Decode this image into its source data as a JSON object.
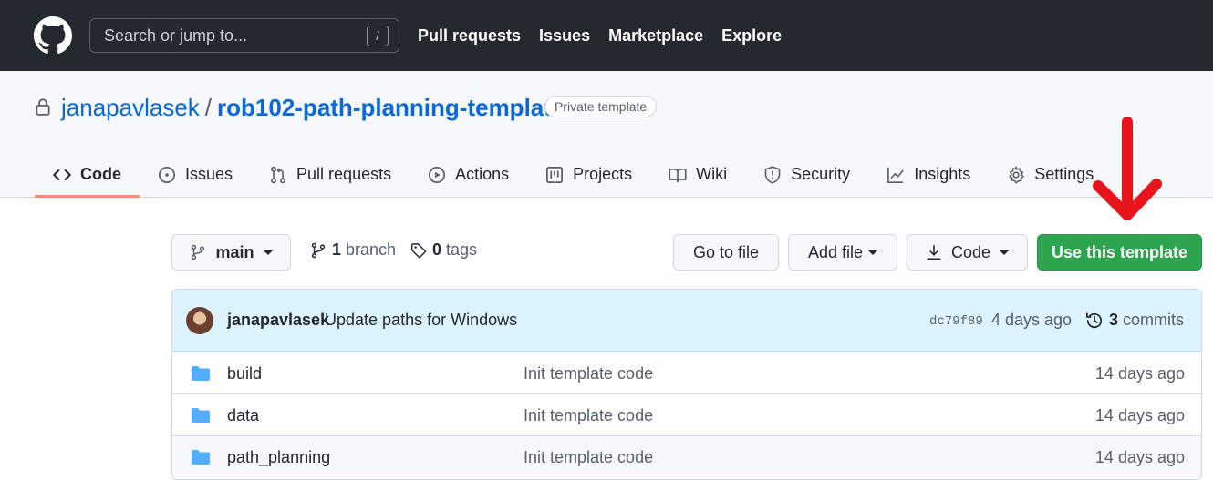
{
  "header": {
    "search_placeholder": "Search or jump to...",
    "search_shortcut": "/",
    "nav": [
      "Pull requests",
      "Issues",
      "Marketplace",
      "Explore"
    ]
  },
  "repo": {
    "owner": "janapavlasek",
    "separator": "/",
    "name": "rob102-path-planning-template",
    "badge": "Private template"
  },
  "tabs": [
    {
      "label": "Code",
      "icon": "code-icon",
      "selected": true
    },
    {
      "label": "Issues",
      "icon": "issue-opened-icon"
    },
    {
      "label": "Pull requests",
      "icon": "git-pull-request-icon"
    },
    {
      "label": "Actions",
      "icon": "play-icon"
    },
    {
      "label": "Projects",
      "icon": "project-icon"
    },
    {
      "label": "Wiki",
      "icon": "book-icon"
    },
    {
      "label": "Security",
      "icon": "shield-icon"
    },
    {
      "label": "Insights",
      "icon": "graph-icon"
    },
    {
      "label": "Settings",
      "icon": "gear-icon"
    }
  ],
  "toolbar": {
    "branch": "main",
    "branch_count": "1",
    "branch_label": "branch",
    "tag_count": "0",
    "tag_label": "tags",
    "go_to_file": "Go to file",
    "add_file": "Add file",
    "code": "Code",
    "use_template": "Use this template"
  },
  "commit": {
    "author": "janapavlasek",
    "message": "Update paths for Windows",
    "sha": "dc79f89",
    "age": "4 days ago",
    "count": "3",
    "count_label": "commits"
  },
  "files": [
    {
      "name": "build",
      "message": "Init template code",
      "age": "14 days ago"
    },
    {
      "name": "data",
      "message": "Init template code",
      "age": "14 days ago"
    },
    {
      "name": "path_planning",
      "message": "Init template code",
      "age": "14 days ago"
    }
  ],
  "colors": {
    "header_bg": "#24292f",
    "link": "#0969da",
    "primary_button": "#2da44e",
    "tab_underline": "#fd8c73",
    "annotation_arrow": "#e8141c",
    "folder": "#54aeff"
  }
}
